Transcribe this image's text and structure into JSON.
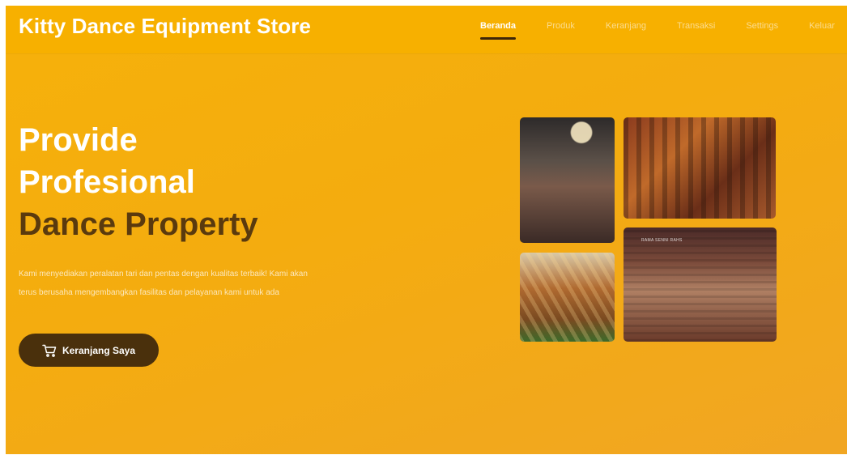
{
  "header": {
    "brand": "Kitty Dance Equipment Store",
    "nav": [
      {
        "label": "Beranda",
        "active": true
      },
      {
        "label": "Produk",
        "active": false
      },
      {
        "label": "Keranjang",
        "active": false
      },
      {
        "label": "Transaksi",
        "active": false
      },
      {
        "label": "Settings",
        "active": false
      },
      {
        "label": "Keluar",
        "active": false
      }
    ]
  },
  "hero": {
    "line1": "Provide",
    "line2": "Profesional",
    "line3": "Dance Property",
    "description": "Kami menyediakan peralatan tari dan pentas dengan kualitas terbaik! Kami akan terus berusaha mengembangkan fasilitas dan pelayanan kami untuk ada",
    "cta_label": "Keranjang Saya",
    "cta_icon": "cart-icon"
  },
  "gallery": {
    "photo4_caption": "RAMA SENNI RAHS"
  },
  "colors": {
    "primary": "#f7b000",
    "dark_accent": "#4a300c",
    "headline_dark": "#5a3a0e"
  }
}
